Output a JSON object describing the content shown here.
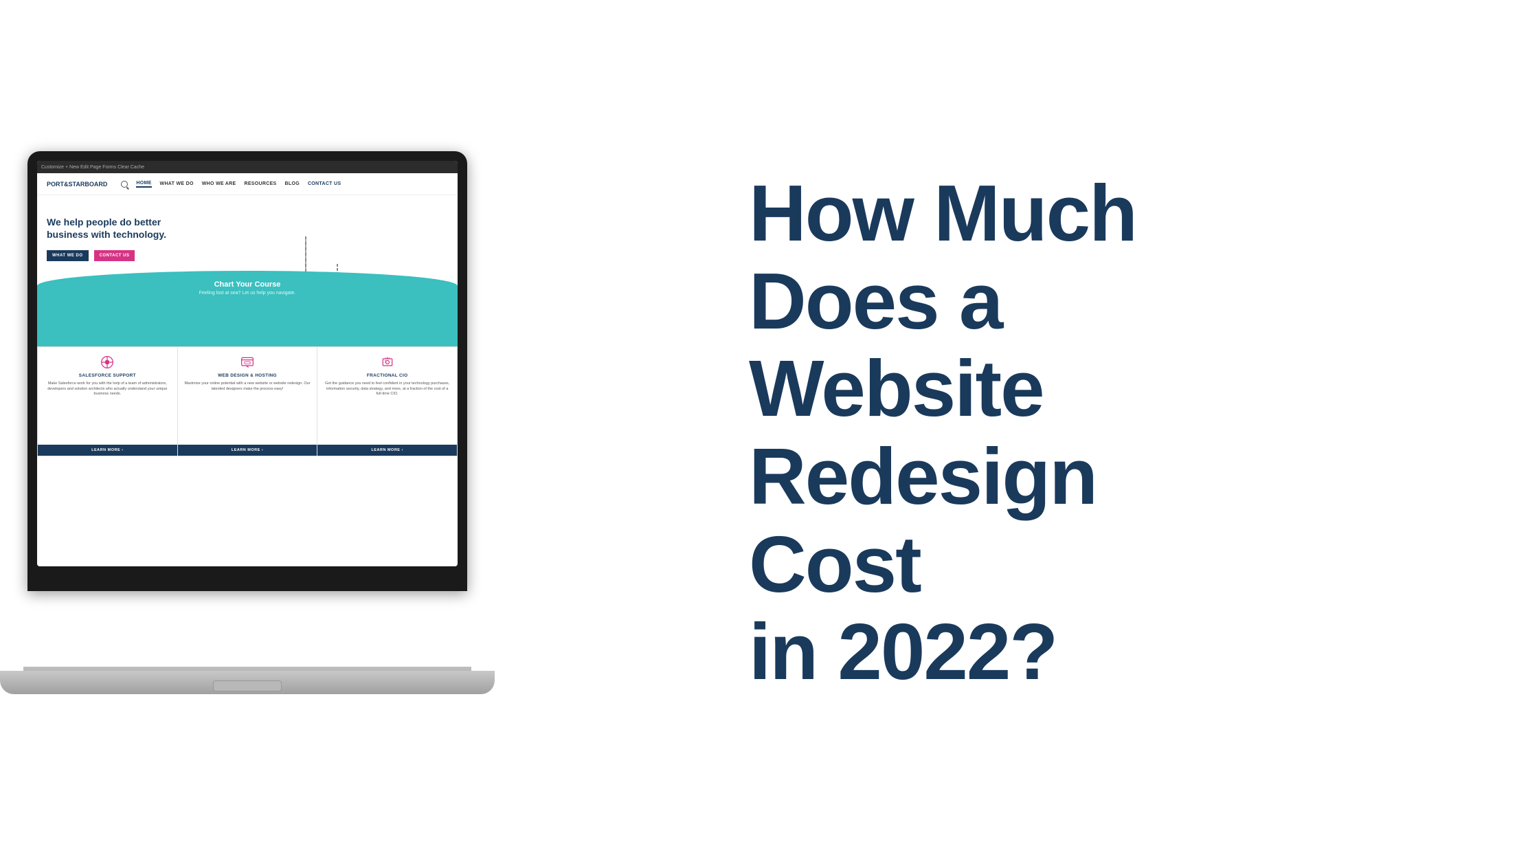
{
  "laptop": {
    "admin_bar_text": "Customize  + New  Edit Page  Forms  Clear Cache",
    "nav": {
      "logo": "PORT&STARBOARD",
      "items": [
        {
          "label": "HOME",
          "active": true
        },
        {
          "label": "WHAT WE DO",
          "dropdown": true
        },
        {
          "label": "WHO WE ARE"
        },
        {
          "label": "RESOURCES"
        },
        {
          "label": "BLOG"
        },
        {
          "label": "CONTACT US"
        }
      ]
    },
    "hero": {
      "headline": "We help people do better business with technology.",
      "btn_what_we_do": "WHAT WE DO",
      "btn_contact_us": "CONTACT US"
    },
    "chart_course": {
      "title": "Chart Your Course",
      "subtitle": "Feeling lost at sea? Let us help you navigate."
    },
    "services": [
      {
        "title": "SALESFORCE SUPPORT",
        "desc": "Make Salesforce work for you with the help of a team of administrators, developers and solution architects who actually understand your unique business needs.",
        "learn_more": "LEARN MORE  ›",
        "icon": "salesforce"
      },
      {
        "title": "WEB DESIGN & HOSTING",
        "desc": "Maximize your online potential with a new website or website redesign. Our talented designers make the process easy!",
        "learn_more": "LEARN MORE  ›",
        "icon": "web"
      },
      {
        "title": "FRACTIONAL CIO",
        "desc": "Get the guidance you need to feel confident in your technology purchases, information security, data strategy, and more, at a fraction of the cost of a full-time CIO.",
        "learn_more": "LEARN MORE  ›",
        "icon": "cio"
      }
    ]
  },
  "headline": {
    "line1": "How Much",
    "line2": "Does a Website",
    "line3": "Redesign Cost",
    "line4": "in 2022?"
  },
  "colors": {
    "navy": "#1a3a5c",
    "teal": "#3bbfbf",
    "pink": "#d63384",
    "white": "#ffffff"
  }
}
